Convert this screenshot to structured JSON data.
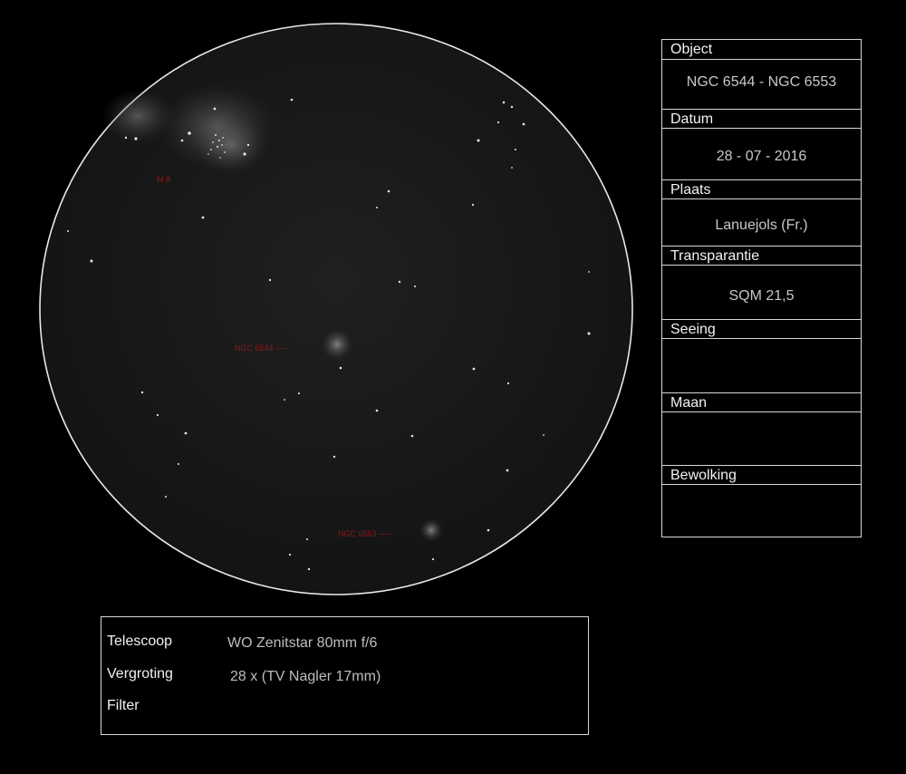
{
  "sketch": {
    "object_labels": {
      "m8": "M 8",
      "ngc6544": "NGC 6544 -----",
      "ngc6553": "NGC 6553 -----"
    },
    "label_color": "#8b1a1a"
  },
  "info": {
    "object_label": "Object",
    "object_value": "NGC 6544 - NGC 6553",
    "date_label": "Datum",
    "date_value": "28 - 07 - 2016",
    "place_label": "Plaats",
    "place_value": "Lanuejols (Fr.)",
    "transparency_label": "Transparantie",
    "transparency_value": "SQM 21,5",
    "seeing_label": "Seeing",
    "moon_label": "Maan",
    "clouds_label": "Bewolking"
  },
  "equipment": {
    "telescope_label": "Telescoop",
    "telescope_value": "WO Zenitstar 80mm f/6",
    "magnification_label": "Vergroting",
    "magnification_value": "28 x (TV Nagler 17mm)",
    "filter_label": "Filter"
  }
}
